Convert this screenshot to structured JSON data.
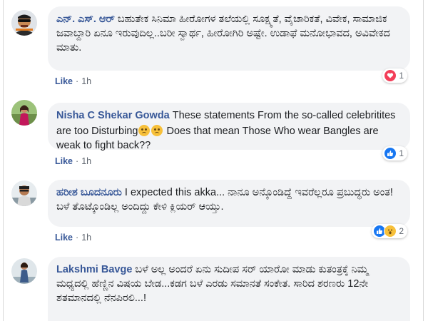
{
  "comments": [
    {
      "author": "ಎನ್. ಎಸ್. ಆರ್",
      "text": "ಬಹುತೇಕ ಸಿನಿಮಾ ಹೀರೋಗಳ ತಲೆಯಲ್ಲಿ ಸೂಕ್ಷ್ಮತೆ, ವೈಚಾರಿಕತೆ, ವಿವೇಕ, ಸಾಮಾಜಿಕ ಜವಾಬ್ದಾರಿ ಏನೂ ಇರುವುದಿಲ್ಲ..ಬರೀ ಸ್ವಾರ್ಥ, ಹೀರೋಗಿರಿ ಅಷ್ಟೇ. ಉಡಾಫೆ ಮನೋಭಾವದ, ಅವಿವೇಕದ ಮಾತು.",
      "like_label": "Like",
      "separator": "·",
      "time": "1h",
      "reaction_icon": "heart-icon",
      "reaction_count": "1"
    },
    {
      "author": "Nisha C Shekar Gowda",
      "text_before": "These statements From the so-called celebritites are too Disturbing",
      "emoji": "sad-face-icon",
      "text_after": " Does that mean Those Who wear Bangles are weak to fight back??",
      "like_label": "Like",
      "separator": "·",
      "time": "1h",
      "reaction_icon": "thumbs-up-icon",
      "reaction_count": "1"
    },
    {
      "author": "ಹರೀಶ ಬೂದನೂರು",
      "text": "I expected this akka... ನಾನೂ ಅನ್ಕೊಂಡಿದ್ದೆ ಇವರೆಲ್ಲರೂ ಪ್ರಬುದ್ಧರು ಅಂತ! ಬಳೆ ತೊಟ್ಕೊಂಡಿಲ್ಲ ಅಂದಿದ್ದು ಕೇಳಿ ಕ್ಲಿಯರ್ ಆಯ್ತು.",
      "like_label": "Like",
      "separator": "·",
      "time": "1h",
      "reaction_icons": [
        "thumbs-up-icon",
        "wow-icon"
      ],
      "reaction_count": "2"
    },
    {
      "author": "Lakshmi Bavge",
      "text": "ಬಳೆ ಅಲ್ಲ ಅಂದರೆ ಏನು ಸುದೀಪ ಸರ್ ಯಾರೋ ಮಾಡು ಕುತಂತ್ರಕ್ಕೆ ನಿಮ್ಮ ಮಧ್ಯದಲ್ಲಿ ಹೆಣ್ಣಿನ ವಿಷಯ ಬೇಡ...ಕಡಗ ಬಳೆ ಎರಡು ಸಮಾನತೆ ಸಂಕೇತ. ಸಾರಿದ ಶರಣರು 12ನೇ ಶತಮಾನದಲ್ಲಿ ನೆನಪಿರಲಿ...!"
    }
  ],
  "colors": {
    "name": "#385898",
    "bubble": "#f2f3f5",
    "heart": "#f33e58",
    "like": "#1877f2",
    "wow": "#f7c03a"
  }
}
